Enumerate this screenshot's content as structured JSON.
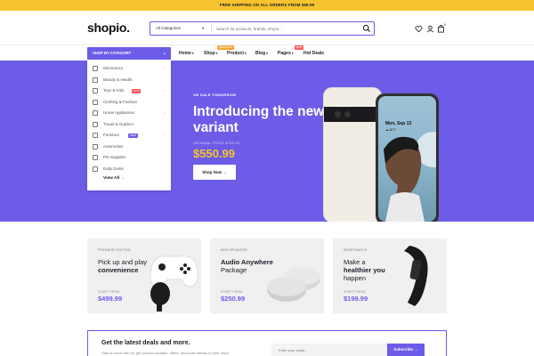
{
  "topbar": {
    "text": "FREE SHIPPING ON ALL ORDERS FROM $59.99"
  },
  "header": {
    "logo": "shopio.",
    "search": {
      "category": "All Categories",
      "placeholder": "Search for products, brands, shops..."
    },
    "cart_count": "0"
  },
  "nav": {
    "category_button": "SHOP BY CATEGORY",
    "items": [
      {
        "label": "Home",
        "badge": ""
      },
      {
        "label": "Shop",
        "badge": "POPULAR"
      },
      {
        "label": "Product",
        "badge": ""
      },
      {
        "label": "Blog",
        "badge": ""
      },
      {
        "label": "Pages",
        "badge": "HOT"
      },
      {
        "label": "Hot Deals",
        "badge": ""
      }
    ]
  },
  "categories": [
    {
      "label": "Electronics",
      "tag": ""
    },
    {
      "label": "Beauty & Health",
      "tag": ""
    },
    {
      "label": "Toys & Kids",
      "tag": "HOT"
    },
    {
      "label": "Clothing & Fashion",
      "tag": ""
    },
    {
      "label": "Home Appliances",
      "tag": ""
    },
    {
      "label": "Travel & Outdoor",
      "tag": ""
    },
    {
      "label": "Furniture",
      "tag": "NEW"
    },
    {
      "label": "Automotive",
      "tag": ""
    },
    {
      "label": "Pet Supplies",
      "tag": ""
    },
    {
      "label": "Daily Deals",
      "tag": ""
    }
  ],
  "view_all": "View All",
  "hero": {
    "kicker": "ON SALE TOMORROW",
    "title": "Introducing the new variant",
    "original_price": "ORIGINAL PRICE $799.00",
    "price": "$550.99",
    "button": "Shop Now",
    "phone_date": "Mon, Sep 13",
    "phone_sub": "☁ 68°F"
  },
  "promos": [
    {
      "kicker": "PREMIERE EDITION",
      "title_line1": "Pick up and play",
      "title_bold": "convenience",
      "start": "START FROM",
      "price": "$499.99"
    },
    {
      "kicker": "MINI SPEAKERS",
      "title_bold": "Audio Anywhere",
      "title_line2": "Package",
      "start": "START FROM",
      "price": "$250.99"
    },
    {
      "kicker": "SMARTWATCH",
      "title_line1": "Make a",
      "title_bold": "healthier you",
      "title_line3": "happen",
      "start": "START FROM",
      "price": "$199.99"
    }
  ],
  "newsletter": {
    "title": "Get the latest deals and more.",
    "subtitle": "Stay in touch with us, get product updates, offers, discounts directly to your inbox",
    "placeholder": "Enter your email...",
    "button": "Subscribe"
  },
  "colors": {
    "accent": "#6c5ce7",
    "topbar": "#f7c32e",
    "price": "#f7c32e",
    "hot": "#ff5a5f",
    "popular": "#f7a62e",
    "new": "#6c5ce7"
  }
}
